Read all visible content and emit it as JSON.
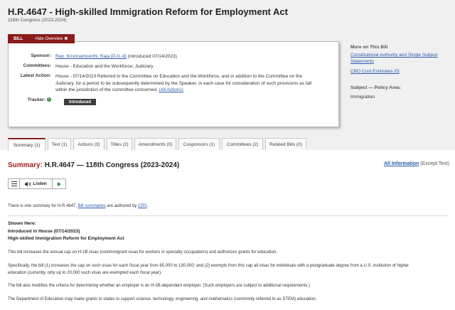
{
  "header": {
    "title": "H.R.4647 - High-skilled Immigration Reform for Employment Act",
    "congress": "118th Congress (2023-2024)"
  },
  "overview": {
    "tab_label": "BILL",
    "hide_label": "Hide Overview",
    "close_glyph": "✖",
    "sponsor_label": "Sponsor:",
    "sponsor_link": "Rep. Krishnamoorthi, Raja [D-IL-8]",
    "sponsor_note": "(Introduced 07/14/2023)",
    "committees_label": "Committees:",
    "committees_value": "House - Education and the Workforce; Judiciary",
    "latest_action_label": "Latest Action:",
    "latest_action_lines": [
      "House - 07/14/2023 Referred to the Committee on Education and the Workforce, and in addition to the Committee on the",
      "Judiciary, for a period to be subsequently determined by the Speaker, in each case for consideration of such provisions as fall",
      "within the jurisdiction of the committee concerned."
    ],
    "all_actions_link": "(All Actions)",
    "tracker_label": "Tracker:",
    "tracker_icon": "info-icon",
    "tracker_status": "Introduced"
  },
  "sidebar": {
    "more_heading": "More on This Bill",
    "links": [
      "Constitutional Authority and Single Subject",
      "Statements",
      "CBO Cost Estimates [0]"
    ],
    "subject_heading": "Subject — Policy Area:",
    "subject_value": "Immigration"
  },
  "tabs": [
    "Summary (1)",
    "Text (1)",
    "Actions (3)",
    "Titles (2)",
    "Amendments (0)",
    "Cosponsors (1)",
    "Committees (2)",
    "Related Bills (0)"
  ],
  "summary": {
    "heading_prefix": "Summary:",
    "heading_rest": "H.R.4647 — 118th Congress (2023-2024)",
    "all_info_link": "All Information",
    "except_text": "(Except Text)",
    "player_listen": "Listen",
    "intro_pre": "There is one summary for H.R.4647.",
    "intro_link1": "Bill summaries",
    "intro_mid": "are authored by",
    "intro_link2": "CRS",
    "intro_end": ".",
    "shown_here": "Shown Here:",
    "introduced": "Introduced in House (07/14/2023)",
    "act_title": "High-skilled Immigration Reform for Employment Act",
    "p1": "This bill increases the annual cap on H-1B visas (nonimmigrant visas for workers in specialty occupations) and authorizes grants for education.",
    "p2_line1": "Specifically, the bill (1) increases the cap on such visas for each fiscal year from 65,000 to 130,000; and (2) exempts from this cap all visas for individuals with a postgraduate degree from a U.S. institution of higher",
    "p2_line2": "education (currently, only up to 20,000 such visas are exempted each fiscal year).",
    "p3": "The bill also modifies the criteria for determining whether an employer is an H-1B-dependent employer. (Such employers are subject to additional requirements.)",
    "p4": "The Department of Education may make grants to states to support science, technology, engineering, and mathematics (commonly referred to as STEM) education."
  },
  "colors": {
    "accent": "#8a1c1c",
    "heading_red": "#a31f1f",
    "link": "#2a5aa8",
    "tracker_green": "#2e8b3e"
  }
}
